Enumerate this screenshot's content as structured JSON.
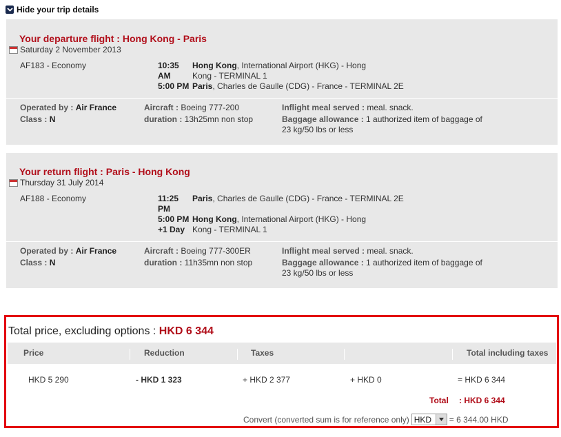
{
  "toggle": {
    "label": "Hide your trip details"
  },
  "departure": {
    "title": "Your departure flight : Hong Kong - Paris",
    "date": "Saturday 2 November 2013",
    "flight": "AF183 - Economy",
    "dep_time": "10:35",
    "dep_time2": "AM",
    "dep_city": "Hong Kong",
    "dep_airport": ", International Airport (HKG) - Hong",
    "dep_airport2": "Kong - TERMINAL 1",
    "arr_time": "5:00 PM",
    "arr_city": "Paris",
    "arr_airport": ", Charles de Gaulle (CDG) - France - TERMINAL 2E",
    "operated_label": "Operated by :",
    "operated": "Air France",
    "class_label": "Class :",
    "class": "N",
    "aircraft_label": "Aircraft :",
    "aircraft": "Boeing 777-200",
    "duration_label": "duration :",
    "duration": "13h25mn non stop",
    "meal_label": "Inflight meal served :",
    "meal": "meal. snack.",
    "baggage_label": "Baggage allowance :",
    "baggage": "1 authorized item of baggage of",
    "baggage2": "23 kg/50 lbs or less"
  },
  "return": {
    "title": "Your return flight : Paris - Hong Kong",
    "date": "Thursday 31 July 2014",
    "flight": "AF188 - Economy",
    "dep_time": "11:25",
    "dep_time2": "PM",
    "dep_city": "Paris",
    "dep_airport": ", Charles de Gaulle (CDG) - France - TERMINAL 2E",
    "arr_time": "5:00 PM",
    "arr_day": "+1 Day",
    "arr_city": "Hong Kong",
    "arr_airport": ", International Airport (HKG) - Hong",
    "arr_airport2": "Kong - TERMINAL 1",
    "operated_label": "Operated by :",
    "operated": "Air France",
    "class_label": "Class :",
    "class": "N",
    "aircraft_label": "Aircraft :",
    "aircraft": "Boeing 777-300ER",
    "duration_label": "duration :",
    "duration": "11h35mn non stop",
    "meal_label": "Inflight meal served :",
    "meal": "meal. snack.",
    "baggage_label": "Baggage allowance :",
    "baggage": "1 authorized item of baggage of",
    "baggage2": "23 kg/50 lbs or less"
  },
  "price": {
    "title": "Total price, excluding options : ",
    "title_amount": "HKD 6 344",
    "headers": [
      "Price",
      "Reduction",
      "Taxes",
      "",
      "Total including taxes"
    ],
    "price": "HKD 5 290",
    "reduction": "- HKD 1 323",
    "taxes": "+ HKD 2 377",
    "other": "+ HKD 0",
    "total_incl": "= HKD 6 344",
    "total_label": "Total",
    "total_value": ": HKD 6 344",
    "convert_label": "Convert (converted sum is for reference only)",
    "currency": "HKD",
    "converted": "= 6 344.00 HKD"
  },
  "colors": {
    "accent_red": "#b10e1a",
    "box_border": "#e3000f",
    "panel_bg": "#e8e8e8"
  }
}
